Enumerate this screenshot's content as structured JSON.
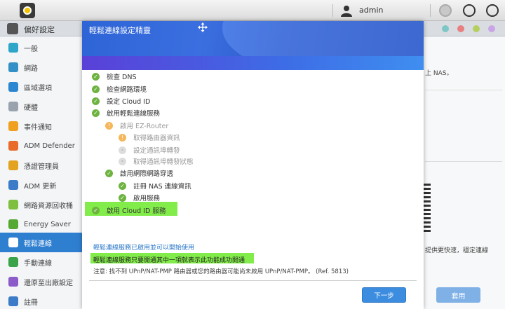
{
  "topbar": {
    "user_name": "admin"
  },
  "window": {
    "title": "偏好設定",
    "dot_colors": [
      "#7fc7c7",
      "#e88080",
      "#b5cf60",
      "#c9a5e8"
    ]
  },
  "sidebar": {
    "items": [
      {
        "label": "一般",
        "icon": "general-icon",
        "color": "#2ea6c9"
      },
      {
        "label": "網路",
        "icon": "globe-icon",
        "color": "#3390c6"
      },
      {
        "label": "區域選項",
        "icon": "region-icon",
        "color": "#2a86d0"
      },
      {
        "label": "硬體",
        "icon": "hardware-icon",
        "color": "#9aa3ad"
      },
      {
        "label": "事件通知",
        "icon": "alert-icon",
        "color": "#f0a020"
      },
      {
        "label": "ADM Defender",
        "icon": "shield-icon",
        "color": "#e96b2c"
      },
      {
        "label": "憑證管理員",
        "icon": "certificate-icon",
        "color": "#e3a21f"
      },
      {
        "label": "ADM 更新",
        "icon": "update-icon",
        "color": "#3b7bc8"
      },
      {
        "label": "網路資源回收桶",
        "icon": "recycle-icon",
        "color": "#7fbf3f"
      },
      {
        "label": "Energy Saver",
        "icon": "energy-icon",
        "color": "#55a832"
      },
      {
        "label": "輕鬆連線",
        "icon": "cloud-icon",
        "color": "#ffffff"
      },
      {
        "label": "手動連線",
        "icon": "manual-connect-icon",
        "color": "#3aa34a"
      },
      {
        "label": "還原至出廠設定",
        "icon": "reset-icon",
        "color": "#8b5cc9"
      },
      {
        "label": "註冊",
        "icon": "register-icon",
        "color": "#3b7bc8"
      }
    ]
  },
  "background": {
    "text1": "上 NAS。",
    "text2": "提供更快速，穩定連線",
    "apply_label": "套用"
  },
  "dialog": {
    "title": "輕鬆連線設定精靈",
    "steps": [
      {
        "label": "檢查 DNS",
        "status": "done"
      },
      {
        "label": "檢查網路環境",
        "status": "done"
      },
      {
        "label": "設定 Cloud ID",
        "status": "done"
      },
      {
        "label": "啟用輕鬆連線服務",
        "status": "done"
      },
      {
        "label": "啟用 EZ-Router",
        "status": "warning"
      },
      {
        "label": "取得路由器資訊",
        "status": "warning"
      },
      {
        "label": "設定通訊埠轉發",
        "status": "pending"
      },
      {
        "label": "取得通訊埠轉發狀態",
        "status": "pending"
      },
      {
        "label": "啟用網際網路穿透",
        "status": "done"
      },
      {
        "label": "註冊 NAS 連線資訊",
        "status": "done"
      },
      {
        "label": "啟用服務",
        "status": "done"
      },
      {
        "label": "啟用 Cloud ID 服務",
        "status": "done"
      }
    ],
    "info_ready": "輕鬆連線服務已啟用並可以開始使用",
    "info_highlight": "輕鬆連線服務只要開通其中一項就表示此功能成功開通",
    "note": "注意: 找不到 UPnP/NAT-PMP 路由器或您的路由器可能尚未啟用 UPnP/NAT-PMP。 (Ref. 5813)",
    "next_label": "下一步"
  }
}
